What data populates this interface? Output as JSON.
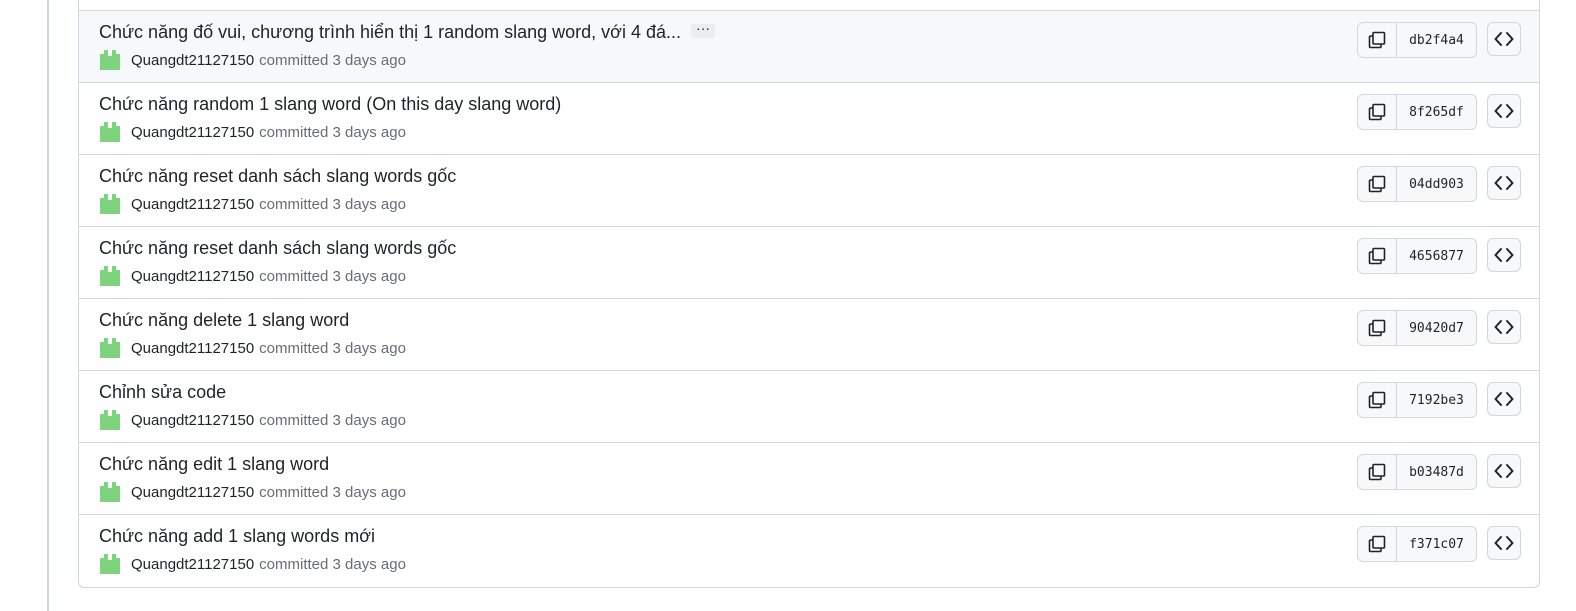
{
  "commits": [
    {
      "title": "Chức năng đố vui, chương trình hiển thị 1 random slang word, với 4 đá...",
      "has_more": true,
      "more_label": "···",
      "author": "Quangdt21127150",
      "committed_text": "committed 3 days ago",
      "sha": "db2f4a4",
      "highlighted": true
    },
    {
      "title": "Chức năng random 1 slang word (On this day slang word)",
      "has_more": false,
      "author": "Quangdt21127150",
      "committed_text": "committed 3 days ago",
      "sha": "8f265df",
      "highlighted": false
    },
    {
      "title": "Chức năng reset danh sách slang words gốc",
      "has_more": false,
      "author": "Quangdt21127150",
      "committed_text": "committed 3 days ago",
      "sha": "04dd903",
      "highlighted": false
    },
    {
      "title": "Chức năng reset danh sách slang words gốc",
      "has_more": false,
      "author": "Quangdt21127150",
      "committed_text": "committed 3 days ago",
      "sha": "4656877",
      "highlighted": false
    },
    {
      "title": "Chức năng delete 1 slang word",
      "has_more": false,
      "author": "Quangdt21127150",
      "committed_text": "committed 3 days ago",
      "sha": "90420d7",
      "highlighted": false
    },
    {
      "title": "Chỉnh sửa code",
      "has_more": false,
      "author": "Quangdt21127150",
      "committed_text": "committed 3 days ago",
      "sha": "7192be3",
      "highlighted": false
    },
    {
      "title": "Chức năng edit 1 slang word",
      "has_more": false,
      "author": "Quangdt21127150",
      "committed_text": "committed 3 days ago",
      "sha": "b03487d",
      "highlighted": false
    },
    {
      "title": "Chức năng add 1 slang words mới",
      "has_more": false,
      "author": "Quangdt21127150",
      "committed_text": "committed 3 days ago",
      "sha": "f371c07",
      "highlighted": false
    }
  ],
  "icons": {
    "avatar": "identicon-avatar",
    "copy": "copy-icon",
    "browse": "code-icon"
  },
  "colors": {
    "avatar": "#7ed37e",
    "border": "#d0d7de",
    "muted_text": "#656d76",
    "highlight_row": "#f6f8fa"
  }
}
